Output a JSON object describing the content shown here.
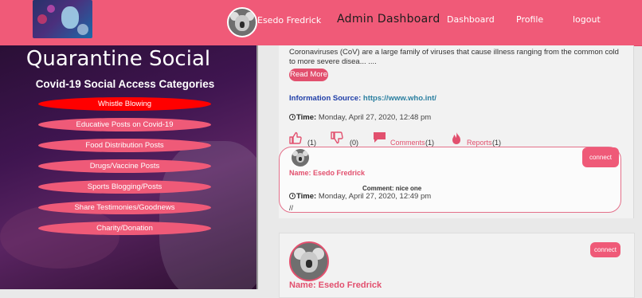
{
  "header": {
    "user_name": "Esedo Fredrick",
    "admin_label": "Admin Dashboard",
    "nav": [
      "Dashboard",
      "Profile",
      "logout"
    ]
  },
  "sidebar": {
    "title": "Quarantine Social",
    "subtitle": "Covid-19 Social Access Categories",
    "categories": [
      "Whistle Blowing",
      "Educative Posts on Covid-19",
      "Food Distribution Posts",
      "Drugs/Vaccine Posts",
      "Sports Blogging/Posts",
      "Share Testimonies/Goodnews",
      "Charity/Donation"
    ],
    "active_index": 0
  },
  "post": {
    "description": "Coronaviruses (CoV) are a large family of viruses that cause illness ranging from the common cold to more severe disea... ....",
    "read_more": "Read More",
    "info_label": "Information Source:",
    "info_link": "https://www.who.int/",
    "time_label": "Time:",
    "time_value": "Monday, April 27, 2020, 12:48 pm",
    "likes": "(1)",
    "dislikes": "(0)",
    "comments_label": "Comments",
    "comments_count": "(1)",
    "reports_label": "Reports",
    "reports_count": "(1)"
  },
  "comment": {
    "connect": "connect",
    "name_line": "Name: Esedo Fredrick",
    "text": "Comment: nice one",
    "time_label": "Time:",
    "time_value": "Monday, April 27, 2020, 12:49 pm",
    "trailer": "//"
  },
  "post2": {
    "connect": "connect",
    "name_line": "Name: Esedo Fredrick"
  },
  "colors": {
    "brand_pink": "#ef5a78",
    "active_red": "#ff0000",
    "link_blue": "#1f3ea8"
  }
}
